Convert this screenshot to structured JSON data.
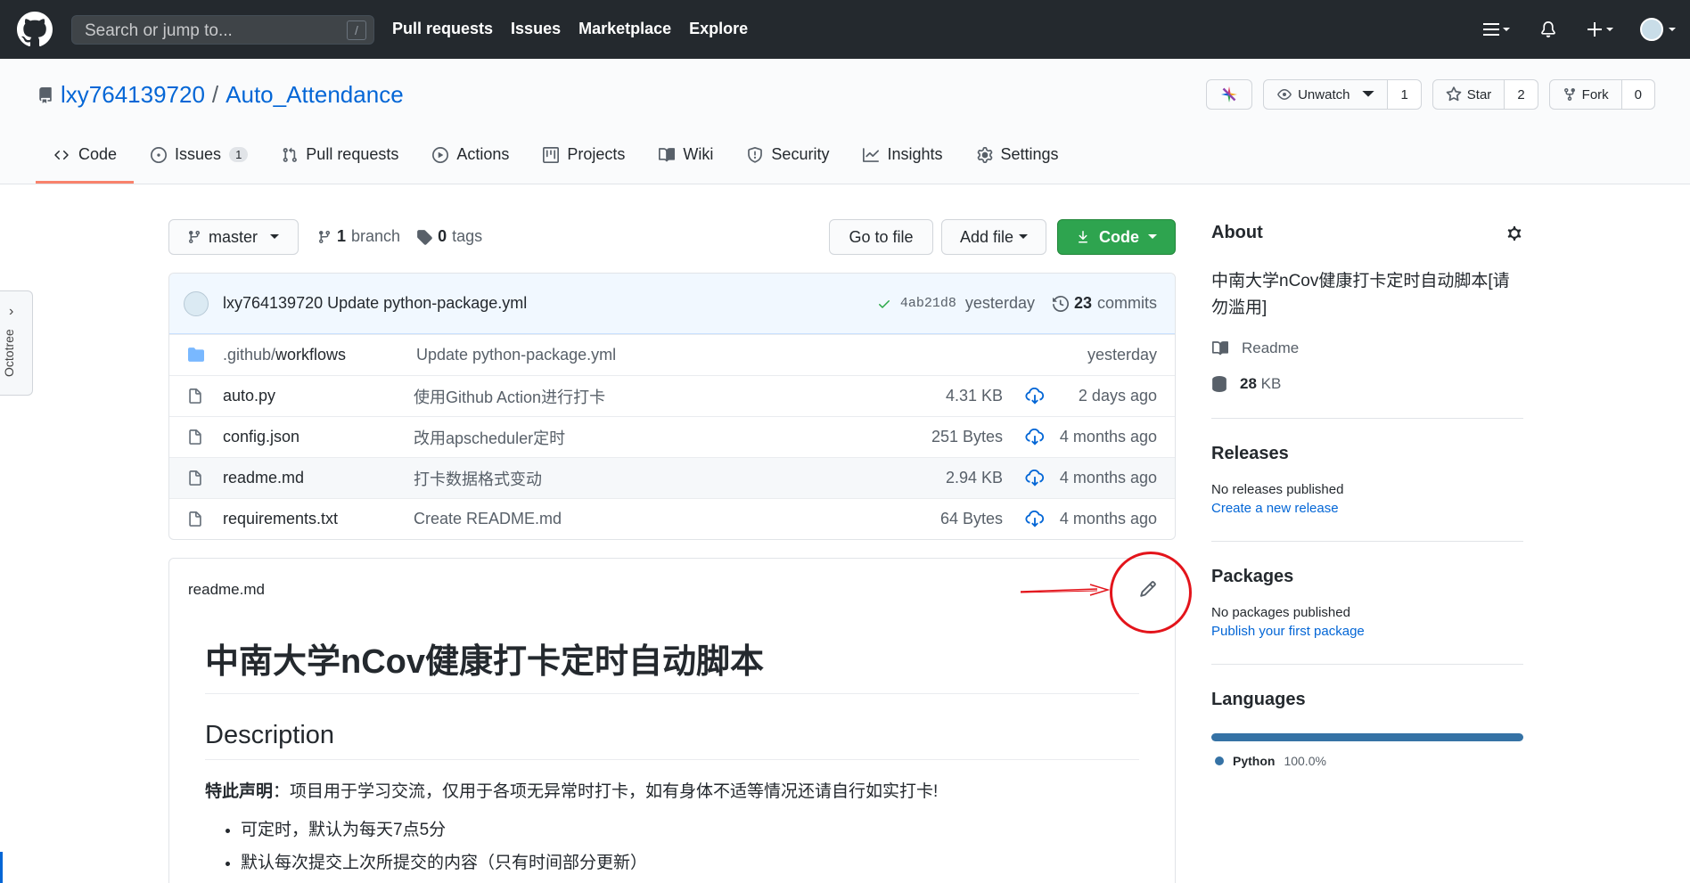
{
  "header": {
    "search_placeholder": "Search or jump to...",
    "search_key": "/",
    "nav": [
      "Pull requests",
      "Issues",
      "Marketplace",
      "Explore"
    ]
  },
  "repo": {
    "owner": "lxy764139720",
    "separator": "/",
    "name": "Auto_Attendance",
    "watch_label": "Unwatch",
    "watch_count": "1",
    "star_label": "Star",
    "star_count": "2",
    "fork_label": "Fork",
    "fork_count": "0"
  },
  "tabs": [
    {
      "label": "Code",
      "badge": ""
    },
    {
      "label": "Issues",
      "badge": "1"
    },
    {
      "label": "Pull requests",
      "badge": ""
    },
    {
      "label": "Actions",
      "badge": ""
    },
    {
      "label": "Projects",
      "badge": ""
    },
    {
      "label": "Wiki",
      "badge": ""
    },
    {
      "label": "Security",
      "badge": ""
    },
    {
      "label": "Insights",
      "badge": ""
    },
    {
      "label": "Settings",
      "badge": ""
    }
  ],
  "octotree": {
    "label": "Octotree",
    "arrow": "›"
  },
  "filenav": {
    "branch": "master",
    "branch_count": "1",
    "branch_word": "branch",
    "tag_count": "0",
    "tag_word": "tags",
    "go_to_file": "Go to file",
    "add_file": "Add file",
    "code": "Code"
  },
  "commit": {
    "author": "lxy764139720",
    "message": "Update python-package.yml",
    "sha": "4ab21d8",
    "time": "yesterday",
    "count": "23",
    "count_word": "commits"
  },
  "files": [
    {
      "name_dim": ".github/",
      "name": "workflows",
      "message": "Update python-package.yml",
      "size": "",
      "time": "yesterday",
      "type": "dir"
    },
    {
      "name_dim": "",
      "name": "auto.py",
      "message": "使用Github Action进行打卡",
      "size": "4.31 KB",
      "time": "2 days ago",
      "type": "file"
    },
    {
      "name_dim": "",
      "name": "config.json",
      "message": "改用apscheduler定时",
      "size": "251 Bytes",
      "time": "4 months ago",
      "type": "file"
    },
    {
      "name_dim": "",
      "name": "readme.md",
      "message": "打卡数据格式变动",
      "size": "2.94 KB",
      "time": "4 months ago",
      "type": "file"
    },
    {
      "name_dim": "",
      "name": "requirements.txt",
      "message": "Create README.md",
      "size": "64 Bytes",
      "time": "4 months ago",
      "type": "file"
    }
  ],
  "readme": {
    "filename": "readme.md",
    "h1": "中南大学nCov健康打卡定时自动脚本",
    "h2": "Description",
    "notice_bold": "特此声明",
    "notice_text": "：项目用于学习交流，仅用于各项无异常时打卡，如有身体不适等情况还请自行如实打卡!",
    "bullets": [
      "可定时，默认为每天7点5分",
      "默认每次提交上次所提交的内容（只有时间部分更新）"
    ]
  },
  "sidebar": {
    "about_title": "About",
    "about_desc": "中南大学nCov健康打卡定时自动脚本[请勿滥用]",
    "readme_label": "Readme",
    "size_value": "28",
    "size_unit": "KB",
    "releases_title": "Releases",
    "releases_none": "No releases published",
    "releases_link": "Create a new release",
    "packages_title": "Packages",
    "packages_none": "No packages published",
    "packages_link": "Publish your first package",
    "languages_title": "Languages",
    "language_name": "Python",
    "language_pct": "100.0%",
    "language_share": 1.0
  },
  "colors": {
    "accent": "#0366d6",
    "code_button": "#2ea44f",
    "python": "#3572a5",
    "annotation": "#e3141b",
    "active_tab": "#f9826c"
  }
}
